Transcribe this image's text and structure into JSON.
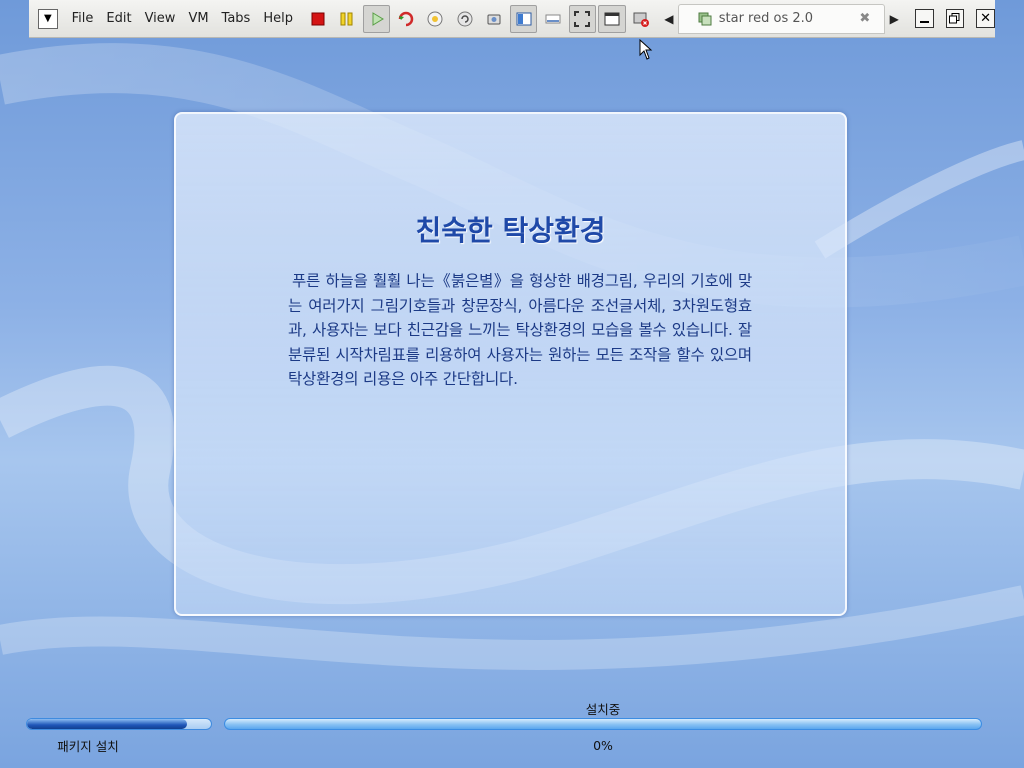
{
  "toolbar": {
    "menus": [
      "File",
      "Edit",
      "View",
      "VM",
      "Tabs",
      "Help"
    ],
    "tab_label": "star red os 2.0",
    "icons": [
      "pin-icon",
      "power-off-icon",
      "suspend-icon",
      "power-on-icon",
      "reset-icon",
      "snapshot-icon",
      "revert-snapshot-icon",
      "snapshot-manager-icon",
      "console-view-icon",
      "thumbnail-bar-icon",
      "full-screen-icon",
      "quick-switch-icon",
      "send-ctrl-alt-del-icon"
    ]
  },
  "panel": {
    "title": "친숙한 탁상환경",
    "body": "푸른 하늘을 훨훨 나는《붉은별》을 형상한 배경그림, 우리의 기호에 맞는 여러가지 그림기호들과 창문장식, 아름다운 조선글서체, 3차원도형효과, 사용자는 보다 친근감을 느끼는 탁상환경의 모습을 볼수 있습니다. 잘 분류된 시작차림표를 리용하여 사용자는 원하는 모든 조작을 할수 있으며 탁상환경의 리용은 아주 간단합니다."
  },
  "install": {
    "package_label": "패키지 설치",
    "package_progress": 0.87,
    "status": "설치중",
    "progress_text": "0%",
    "progress": 0.0
  },
  "colors": {
    "accent": "#1f56b8",
    "title": "#1f49a8",
    "background": "#8db1e6"
  }
}
